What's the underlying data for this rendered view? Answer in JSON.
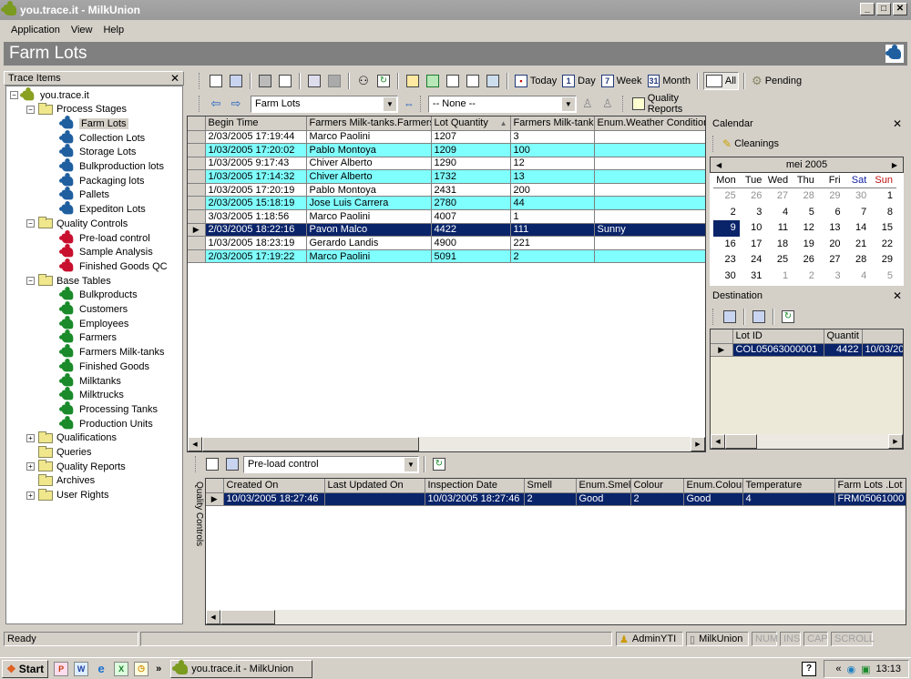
{
  "window": {
    "title": "you.trace.it - MilkUnion"
  },
  "menu": [
    "Application",
    "View",
    "Help"
  ],
  "banner": {
    "title": "Farm Lots"
  },
  "left_panel": {
    "title": "Trace Items",
    "root": "you.trace.it",
    "groups": [
      {
        "label": "Process Stages",
        "expanded": true,
        "color": "blue",
        "items": [
          "Farm Lots",
          "Collection Lots",
          "Storage Lots",
          "Bulkproduction lots",
          "Packaging lots",
          "Pallets",
          "Expediton Lots"
        ]
      },
      {
        "label": "Quality Controls",
        "expanded": true,
        "color": "red",
        "items": [
          "Pre-load control",
          "Sample Analysis",
          "Finished Goods QC"
        ]
      },
      {
        "label": "Base Tables",
        "expanded": true,
        "color": "green",
        "items": [
          "Bulkproducts",
          "Customers",
          "Employees",
          "Farmers",
          "Farmers Milk-tanks",
          "Finished Goods",
          "Milktanks",
          "Milktrucks",
          "Processing Tanks",
          "Production Units"
        ]
      },
      {
        "label": "Qualifications",
        "expandable": true,
        "items": []
      },
      {
        "label": "Queries",
        "expandable": false,
        "items": []
      },
      {
        "label": "Quality Reports",
        "expandable": true,
        "items": []
      },
      {
        "label": "Archives",
        "expandable": false,
        "items": []
      },
      {
        "label": "User Rights",
        "expandable": true,
        "items": []
      }
    ],
    "selected": "Farm Lots"
  },
  "toolbar": {
    "today": "Today",
    "day": "Day",
    "week": "Week",
    "month": "Month",
    "all": "All",
    "pending": "Pending",
    "day_num": "1",
    "week_num": "7",
    "month_num": "31"
  },
  "toolbar2": {
    "view_combo": "Farm Lots",
    "filter_combo": "-- None --",
    "quality_reports": "Quality Reports"
  },
  "main_grid": {
    "columns": [
      "Begin Time",
      "Farmers Milk-tanks.Farmers",
      "Lot Quantity",
      "Farmers Milk-tanks",
      "Enum.Weather Conditions"
    ],
    "sort_indicator": "▲",
    "rows": [
      [
        "2/03/2005 17:19:44",
        "Marco Paolini",
        "1207",
        "3",
        ""
      ],
      [
        "1/03/2005 17:20:02",
        "Pablo Montoya",
        "1209",
        "100",
        ""
      ],
      [
        "1/03/2005 9:17:43",
        "Chiver Alberto",
        "1290",
        "12",
        ""
      ],
      [
        "1/03/2005 17:14:32",
        "Chiver Alberto",
        "1732",
        "13",
        ""
      ],
      [
        "1/03/2005 17:20:19",
        "Pablo Montoya",
        "2431",
        "200",
        ""
      ],
      [
        "2/03/2005 15:18:19",
        "Jose Luis Carrera",
        "2780",
        "44",
        ""
      ],
      [
        "3/03/2005 1:18:56",
        "Marco Paolini",
        "4007",
        "1",
        ""
      ],
      [
        "2/03/2005 18:22:16",
        "Pavon Malco",
        "4422",
        "111",
        "Sunny"
      ],
      [
        "1/03/2005 18:23:19",
        "Gerardo Landis",
        "4900",
        "221",
        ""
      ],
      [
        "2/03/2005 17:19:22",
        "Marco Paolini",
        "5091",
        "2",
        ""
      ]
    ],
    "selected_row": 7
  },
  "calendar": {
    "title": "Calendar",
    "cleanings": "Cleanings",
    "month_label": "mei 2005",
    "weekdays": [
      "Mon",
      "Tue",
      "Wed",
      "Thu",
      "Fri",
      "Sat",
      "Sun"
    ],
    "days": [
      [
        "25",
        "26",
        "27",
        "28",
        "29",
        "30",
        "1"
      ],
      [
        "2",
        "3",
        "4",
        "5",
        "6",
        "7",
        "8"
      ],
      [
        "9",
        "10",
        "11",
        "12",
        "13",
        "14",
        "15"
      ],
      [
        "16",
        "17",
        "18",
        "19",
        "20",
        "21",
        "22"
      ],
      [
        "23",
        "24",
        "25",
        "26",
        "27",
        "28",
        "29"
      ],
      [
        "30",
        "31",
        "1",
        "2",
        "3",
        "4",
        "5"
      ]
    ],
    "selected_day": "9"
  },
  "destination": {
    "title": "Destination",
    "columns": [
      "Lot ID",
      "Quantit",
      ""
    ],
    "rows": [
      [
        "COL05063000001",
        "4422",
        "10/03/20"
      ]
    ]
  },
  "qc_panel": {
    "tab_label": "Quality Controls",
    "combo": "Pre-load control",
    "columns": [
      "Created On",
      "Last Updated On",
      "Inspection Date",
      "Smell",
      "Enum.Smell",
      "Colour",
      "Enum.Colour",
      "Temperature",
      "Farm Lots .Lot I"
    ],
    "rows": [
      [
        "10/03/2005 18:27:46",
        "",
        "10/03/2005 18:27:46",
        "2",
        "Good",
        "2",
        "Good",
        "4",
        "FRM05061000"
      ]
    ]
  },
  "statusbar": {
    "status": "Ready",
    "user": "AdminYTI",
    "db": "MilkUnion",
    "num": "NUM",
    "ins": "INS",
    "cap": "CAP",
    "scroll": "SCROLL"
  },
  "taskbar": {
    "start": "Start",
    "task": "you.trace.it - MilkUnion",
    "clock": "13:13",
    "chevron": "»",
    "tray_chevron": "«"
  }
}
